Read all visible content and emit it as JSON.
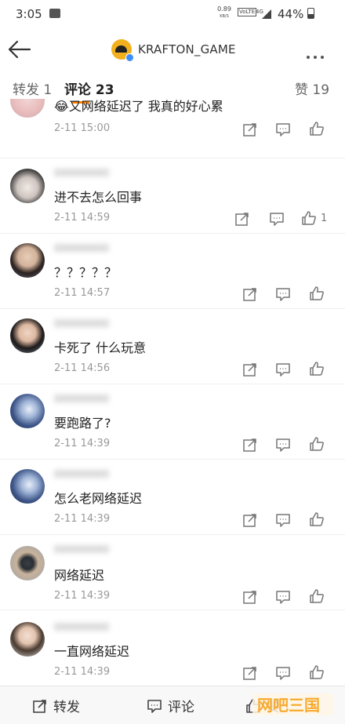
{
  "status_bar": {
    "time": "3:05",
    "net_speed_top": "0.89",
    "net_speed_bottom": "KB/S",
    "volte": "VoLTE",
    "signal": "4G",
    "battery": "44%"
  },
  "header": {
    "title": "KRAFTON_GAME"
  },
  "tabs": [
    {
      "label": "转发 1"
    },
    {
      "label": "评论 23"
    },
    {
      "label": "赞 19"
    }
  ],
  "comments": [
    {
      "text": "😂又网络延迟了 我真的好心累",
      "time": "2-11 15:00",
      "likes": ""
    },
    {
      "text": "进不去怎么回事",
      "time": "2-11 14:59",
      "likes": "1"
    },
    {
      "text": "？？？？？",
      "time": "2-11 14:57",
      "likes": ""
    },
    {
      "text": "卡死了 什么玩意",
      "time": "2-11 14:56",
      "likes": ""
    },
    {
      "text": "要跑路了?",
      "time": "2-11 14:39",
      "likes": ""
    },
    {
      "text": "怎么老网络延迟",
      "time": "2-11 14:39",
      "likes": ""
    },
    {
      "text": "网络延迟",
      "time": "2-11 14:39",
      "likes": ""
    },
    {
      "text": "一直网络延迟",
      "time": "2-11 14:39",
      "likes": ""
    }
  ],
  "bottom_bar": {
    "forward": "转发",
    "comment": "评论",
    "like": "赞"
  },
  "colors": {
    "accent": "#ff8200",
    "logo": "#f2b01e",
    "verify": "#3d8ff5"
  },
  "icons": {
    "back": "arrow-left-icon",
    "more": "more-dots-icon",
    "share": "share-icon",
    "reply": "comment-icon",
    "like": "thumbs-up-icon"
  }
}
